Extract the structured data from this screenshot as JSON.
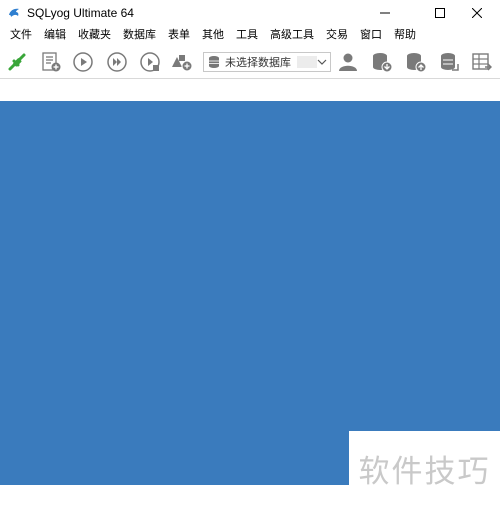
{
  "window": {
    "title": "SQLyog Ultimate 64"
  },
  "menu": {
    "items": [
      "文件",
      "编辑",
      "收藏夹",
      "数据库",
      "表单",
      "其他",
      "工具",
      "高级工具",
      "交易",
      "窗口",
      "帮助"
    ]
  },
  "toolbar": {
    "db_select_value": "未选择数据库",
    "icons": [
      "connect-icon",
      "new-query-icon",
      "execute-icon",
      "execute-all-icon",
      "execute-edit-icon",
      "schema-designer-icon",
      "user-manager-icon",
      "backup-database-icon",
      "restore-database-icon",
      "import-external-icon",
      "export-table-icon"
    ]
  },
  "colors": {
    "workspace": "#3a7bbd",
    "icon_gray": "#7a7a7a",
    "connect_green": "#3aa63a"
  },
  "watermark": {
    "text": "软件技巧"
  }
}
